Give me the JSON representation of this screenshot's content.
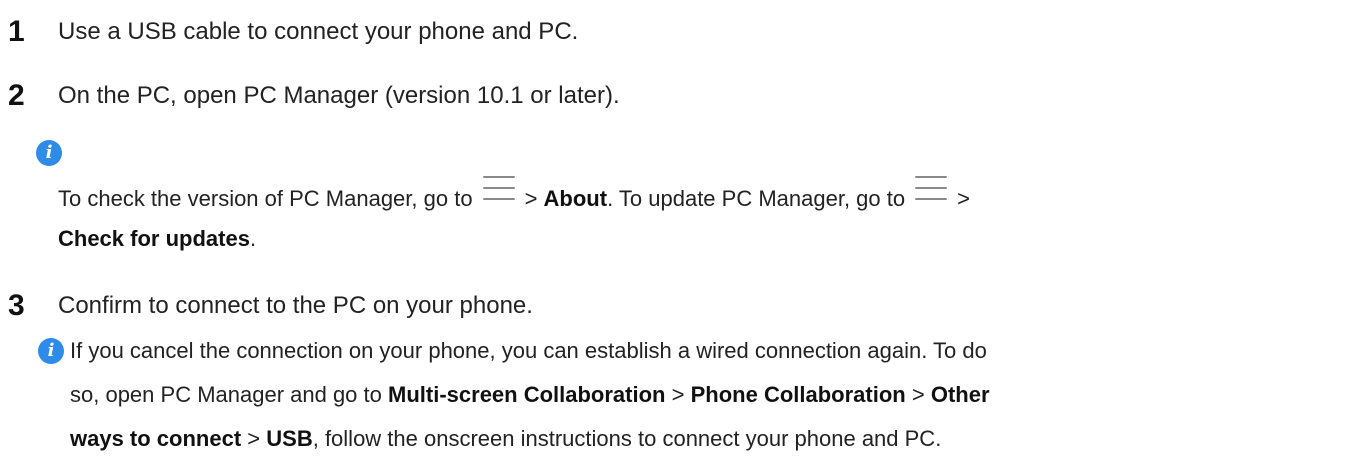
{
  "steps": [
    {
      "number": "1",
      "text": "Use a USB cable to connect your phone and PC."
    },
    {
      "number": "2",
      "text": "On the PC, open PC Manager (version 10.1 or later).",
      "note": {
        "icon": "info-icon",
        "part1": "To check the version of PC Manager, go to",
        "sep1": ">",
        "bold1": "About",
        "part2": ". To update PC Manager, go to",
        "sep2": ">",
        "bold2": "Check for updates",
        "end": "."
      }
    },
    {
      "number": "3",
      "text": "Confirm to connect to the PC on your phone.",
      "note": {
        "icon": "info-icon",
        "line1": "If you cancel the connection on your phone, you can establish a wired connection again. To do",
        "part1": "so, open PC Manager and go to",
        "bold1": "Multi-screen Collaboration",
        "sep1": ">",
        "bold2": "Phone Collaboration",
        "sep2": ">",
        "bold3": "Other",
        "bold4": "ways to connect",
        "sep3": ">",
        "bold5": "USB",
        "part2": ", follow the onscreen instructions to connect your phone and PC."
      }
    }
  ],
  "colors": {
    "info_icon": "#2f8be8",
    "menu_icon": "#8a8a8a",
    "text": "#222222"
  }
}
